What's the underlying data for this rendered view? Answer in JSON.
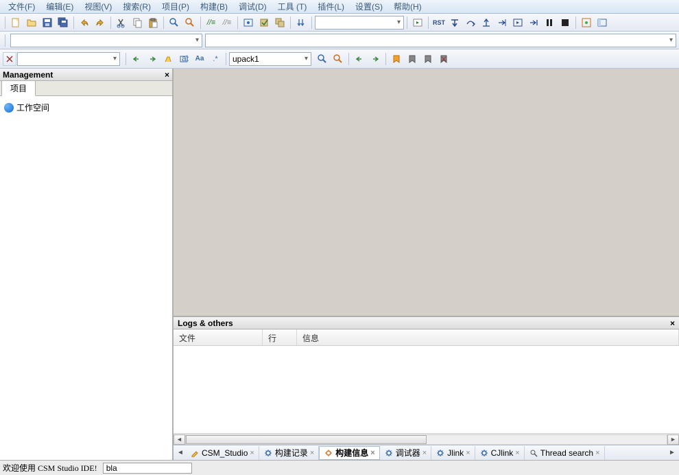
{
  "menubar": [
    "文件(F)",
    "编辑(E)",
    "视图(V)",
    "搜索(R)",
    "项目(P)",
    "构建(B)",
    "调试(D)",
    "工具 (T)",
    "插件(L)",
    "设置(S)",
    "帮助(H)"
  ],
  "management": {
    "title": "Management",
    "tab": "项目",
    "root": "工作空间"
  },
  "search": {
    "combo_value": "",
    "upack_value": "upack1"
  },
  "logs": {
    "title": "Logs & others",
    "cols": {
      "file": "文件",
      "line": "行",
      "info": "信息"
    }
  },
  "bottom_tabs": [
    {
      "label": "CSM_Studio",
      "icon": "edit",
      "active": false
    },
    {
      "label": "构建记录",
      "icon": "gear",
      "active": false
    },
    {
      "label": "构建信息",
      "icon": "gear-orange",
      "active": true
    },
    {
      "label": "调试器",
      "icon": "gear",
      "active": false
    },
    {
      "label": "Jlink",
      "icon": "gear",
      "active": false
    },
    {
      "label": "CJlink",
      "icon": "gear",
      "active": false
    },
    {
      "label": "Thread search",
      "icon": "search",
      "active": false
    }
  ],
  "status": {
    "message": "欢迎使用 CSM Studio IDE!",
    "input": "bla"
  }
}
